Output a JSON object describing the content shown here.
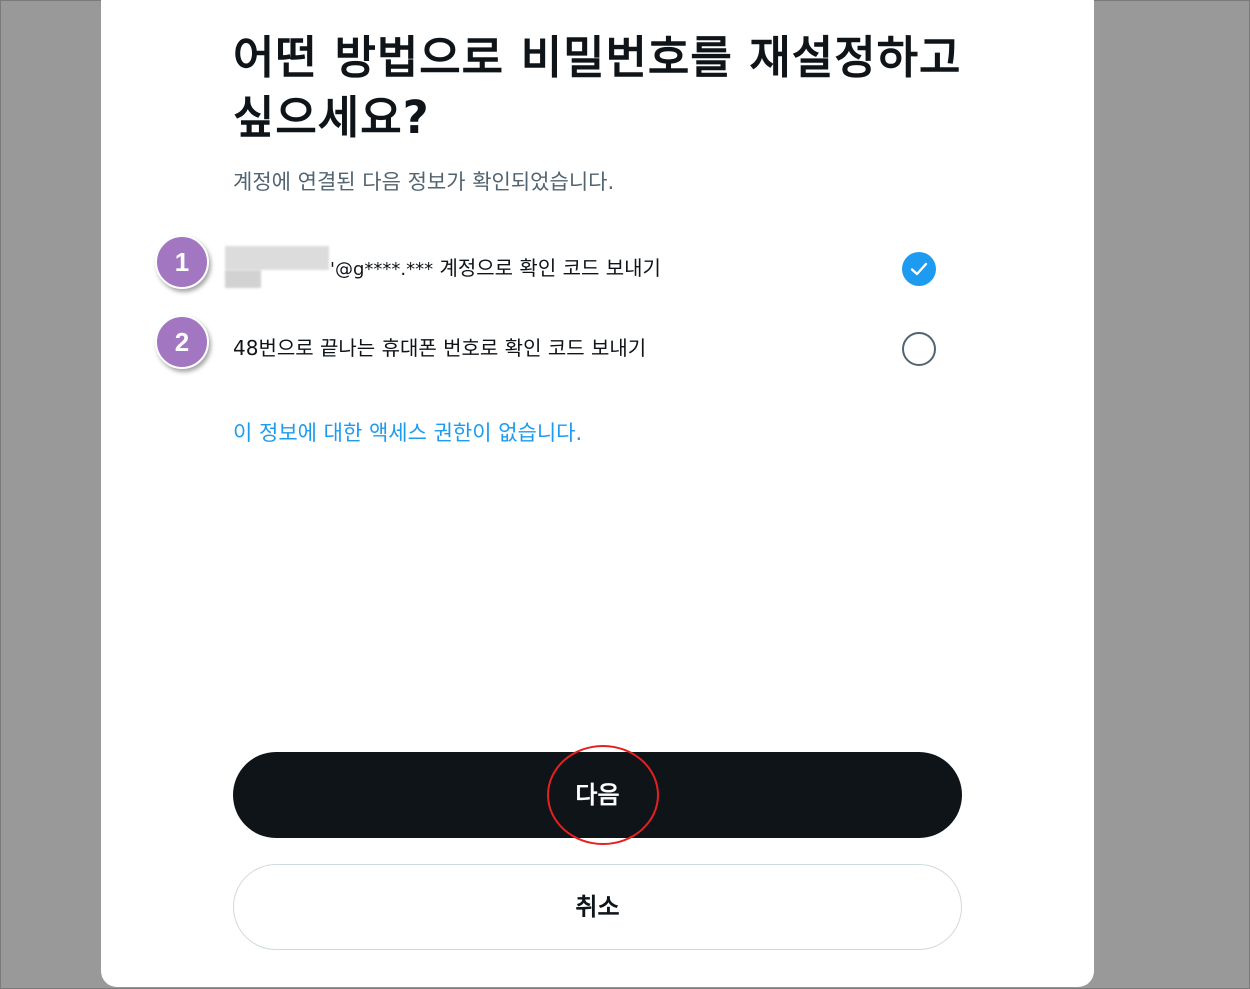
{
  "dialog": {
    "title": "어떤 방법으로 비밀번호를 재설정하고 싶으세요?",
    "subtitle": "계정에 연결된 다음 정보가 확인되었습니다."
  },
  "options": [
    {
      "badge": "1",
      "email_suffix": "'@g****.***",
      "label": " 계정으로 확인 코드 보내기",
      "selected": true
    },
    {
      "badge": "2",
      "label": "48번으로 끝나는 휴대폰 번호로 확인 코드 보내기",
      "selected": false
    }
  ],
  "no_access_link": "이 정보에 대한 액세스 권한이 없습니다.",
  "buttons": {
    "next_label": "다음",
    "cancel_label": "취소"
  },
  "colors": {
    "accent": "#1d9bf0",
    "primary_button": "#0f1419",
    "badge": "#a276c1",
    "highlight": "#e52020"
  }
}
